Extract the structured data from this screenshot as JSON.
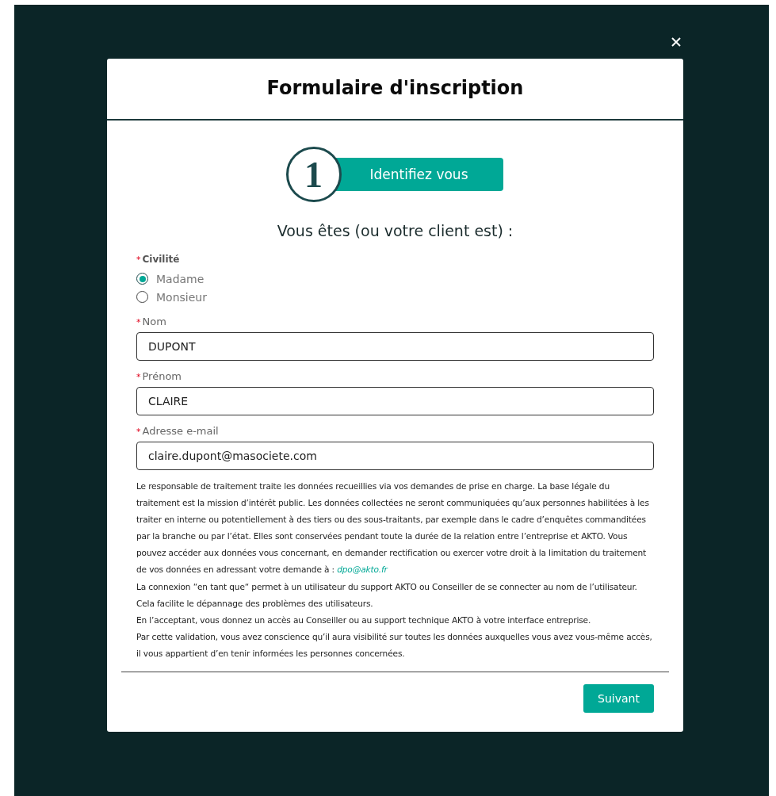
{
  "modal": {
    "title": "Formulaire d'inscription"
  },
  "step": {
    "number": "1",
    "label": "Identifiez vous"
  },
  "heading": "Vous êtes (ou votre client est) :",
  "civility": {
    "label": "Civilité",
    "required_mark": "*",
    "options": [
      {
        "label": "Madame",
        "selected": true
      },
      {
        "label": "Monsieur",
        "selected": false
      }
    ]
  },
  "fields": [
    {
      "label": "Nom",
      "required_mark": "*",
      "value": "DUPONT"
    },
    {
      "label": "Prénom",
      "required_mark": "*",
      "value": "CLAIRE"
    },
    {
      "label": "Adresse e-mail",
      "required_mark": "*",
      "value": "claire.dupont@masociete.com"
    }
  ],
  "privacy": {
    "text": "Le responsable de traitement traite les données recueillies via vos demandes de prise en charge. La base légale du traitement est la mission d’intérêt public. Les données collectées ne seront communiquées qu’aux personnes habilitées à les traiter en interne ou potentiellement à des tiers ou des sous-traitants, par exemple dans le cadre d’enquêtes commanditées par la branche ou par l’état. Elles sont conservées pendant toute la durée de la relation entre l’entreprise et AKTO. Vous pouvez accéder aux données vous concernant, en demander rectification ou exercer votre droit à la limitation du traitement de vos données en adressant votre demande à :",
    "link": "dpo@akto.fr"
  },
  "notices": [
    "La connexion “en tant que“ permet à un utilisateur du support AKTO ou Conseiller de se connecter au nom de l’utilisateur. Cela facilite le dépannage des problèmes des utilisateurs.",
    "En l’acceptant, vous donnez un accès au Conseiller ou au support technique AKTO à votre interface entreprise.",
    "Par cette validation, vous avez conscience qu’il aura visibilité sur toutes les données auxquelles vous avez vous-même accès, il vous appartient d’en tenir informées les personnes concernées."
  ],
  "buttons": [
    "Suivant"
  ]
}
